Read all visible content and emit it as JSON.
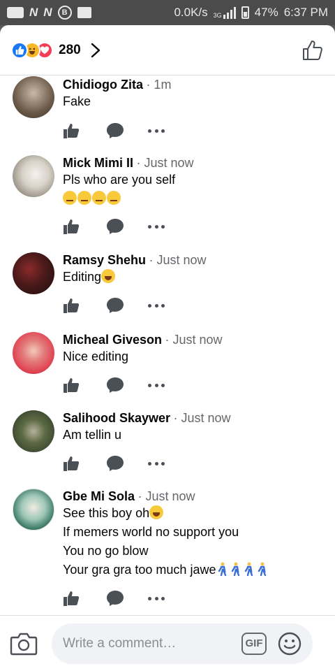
{
  "status_bar": {
    "speed": "0.0K/s",
    "network": "3G",
    "battery": "47%",
    "time": "6:37 PM"
  },
  "header": {
    "reaction_icons": [
      "like-reaction",
      "haha-reaction",
      "love-reaction"
    ],
    "reaction_count": "280"
  },
  "comments": [
    {
      "name": "Chidiogo Zita",
      "time": "· 1m",
      "lines": [
        "Fake"
      ],
      "avatar_color": "#6b5a4a"
    },
    {
      "name": "Mick Mimi II",
      "time": "· Just now",
      "lines": [
        "Pls who are you self"
      ],
      "emoji_line": "unamused x4",
      "avatar_color": "#a8a39a"
    },
    {
      "name": "Ramsy Shehu",
      "time": "· Just now",
      "lines": [
        "Editing"
      ],
      "avatar_color": "#4a1a1a"
    },
    {
      "name": "Micheal Giveson",
      "time": "· Just now",
      "lines": [
        "Nice editing"
      ],
      "avatar_color": "#e04050"
    },
    {
      "name": "Salihood Skaywer",
      "time": "· Just now",
      "lines": [
        "Am tellin u"
      ],
      "avatar_color": "#3c4a2e"
    },
    {
      "name": "Gbe Mi Sola",
      "time": "· Just now",
      "lines": [
        "See this boy oh",
        "If memers world no support you",
        "You no go blow",
        "Your gra gra too much jawe"
      ],
      "avatar_color": "#2f6f5a"
    }
  ],
  "composer": {
    "placeholder": "Write a comment…",
    "gif_label": "GIF"
  },
  "colors": {
    "like_blue": "#1877f2",
    "haha_yellow": "#f7b928",
    "love_red": "#f33e58",
    "secondary_text": "#65676b",
    "icon_gray": "#4b4f56"
  }
}
